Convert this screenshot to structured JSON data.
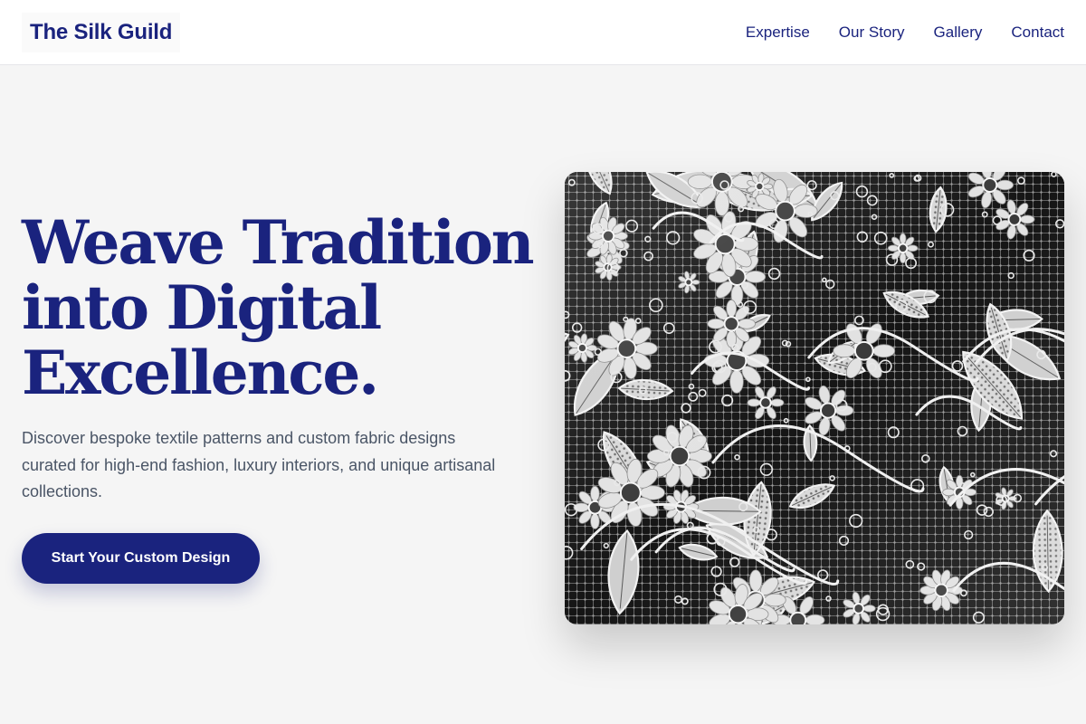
{
  "header": {
    "logo": "The Silk Guild",
    "nav": [
      "Expertise",
      "Our Story",
      "Gallery",
      "Contact"
    ]
  },
  "hero": {
    "headline_lines": [
      "Weave Tradition",
      "into Digital",
      "Excellence."
    ],
    "subtext": "Discover bespoke textile patterns and custom fabric designs curated for high-end fashion, luxury interiors, and unique artisanal collections.",
    "cta_label": "Start Your Custom Design"
  },
  "image": {
    "subject": "black-and-white floral lace fabric"
  },
  "colors": {
    "brand": "#1a237e",
    "background": "#f5f5f5",
    "body_text": "#4a5566",
    "header_bg": "#ffffff"
  }
}
